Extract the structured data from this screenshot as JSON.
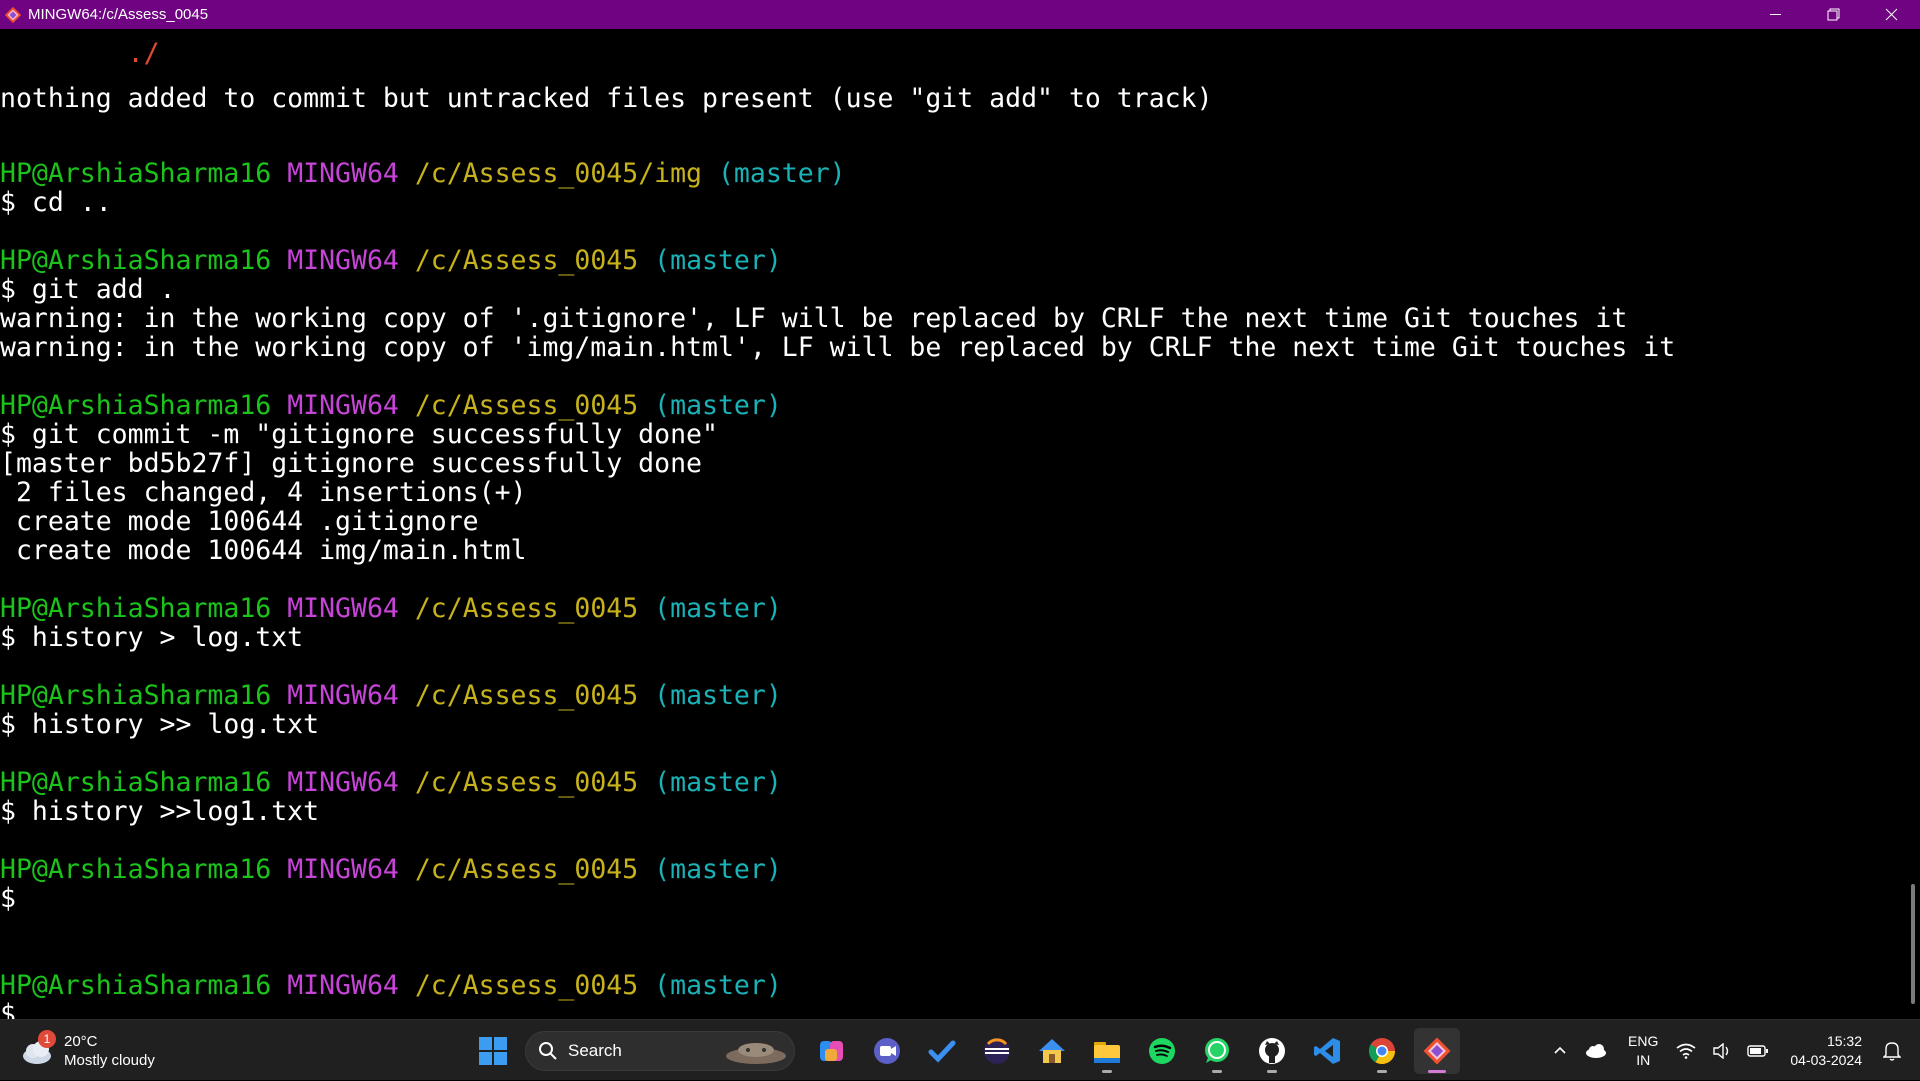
{
  "window": {
    "title": "MINGW64:/c/Assess_0045"
  },
  "terminal": {
    "lines": [
      {
        "top": 0,
        "segments": [
          {
            "text": "        ./",
            "color": "#e04a3a"
          }
        ]
      },
      {
        "top": 0,
        "segments": [
          {
            "text": "nothing added to commit but untracked files present (use \"git add\" to track)",
            "color": "#ffffff"
          }
        ]
      },
      {
        "top": 0,
        "segments": []
      },
      {
        "top": 0,
        "segments": [
          {
            "text": "HP@ArshiaSharma16",
            "cls": "c-green"
          },
          {
            "text": " MINGW64",
            "cls": "c-purple"
          },
          {
            "text": " /c/Assess_0045/img",
            "cls": "c-yellow"
          },
          {
            "text": " (master)",
            "cls": "c-cyan"
          }
        ]
      },
      {
        "top": 0,
        "segments": [
          {
            "text": "$ cd .."
          }
        ]
      },
      {
        "top": 0,
        "segments": [
          {
            "text": "HP@ArshiaSharma16",
            "cls": "c-green"
          },
          {
            "text": " MINGW64",
            "cls": "c-purple"
          },
          {
            "text": " /c/Assess_0045",
            "cls": "c-yellow"
          },
          {
            "text": " (master)",
            "cls": "c-cyan"
          }
        ]
      },
      {
        "top": 0,
        "segments": [
          {
            "text": "$ git add ."
          }
        ]
      },
      {
        "top": 0,
        "segments": [
          {
            "text": "warning: in the working copy of '.gitignore', LF will be replaced by CRLF the next time Git touches it"
          }
        ]
      },
      {
        "top": 0,
        "segments": [
          {
            "text": "warning: in the working copy of 'img/main.html', LF will be replaced by CRLF the next time Git touches it"
          }
        ]
      },
      {
        "top": 0,
        "segments": [
          {
            "text": "HP@ArshiaSharma16",
            "cls": "c-green"
          },
          {
            "text": " MINGW64",
            "cls": "c-purple"
          },
          {
            "text": " /c/Assess_0045",
            "cls": "c-yellow"
          },
          {
            "text": " (master)",
            "cls": "c-cyan"
          }
        ]
      },
      {
        "top": 0,
        "segments": [
          {
            "text": "$ git commit -m \"gitignore successfully done\""
          }
        ]
      },
      {
        "top": 0,
        "segments": [
          {
            "text": "[master bd5b27f] gitignore successfully done"
          }
        ]
      },
      {
        "top": 0,
        "segments": [
          {
            "text": " 2 files changed, 4 insertions(+)"
          }
        ]
      },
      {
        "top": 0,
        "segments": [
          {
            "text": " create mode 100644 .gitignore"
          }
        ]
      },
      {
        "top": 0,
        "segments": [
          {
            "text": " create mode 100644 img/main.html"
          }
        ]
      },
      {
        "top": 0,
        "segments": [
          {
            "text": "HP@ArshiaSharma16",
            "cls": "c-green"
          },
          {
            "text": " MINGW64",
            "cls": "c-purple"
          },
          {
            "text": " /c/Assess_0045",
            "cls": "c-yellow"
          },
          {
            "text": " (master)",
            "cls": "c-cyan"
          }
        ]
      },
      {
        "top": 0,
        "segments": [
          {
            "text": "$ history > log.txt"
          }
        ]
      },
      {
        "top": 0,
        "segments": [
          {
            "text": "HP@ArshiaSharma16",
            "cls": "c-green"
          },
          {
            "text": " MINGW64",
            "cls": "c-purple"
          },
          {
            "text": " /c/Assess_0045",
            "cls": "c-yellow"
          },
          {
            "text": " (master)",
            "cls": "c-cyan"
          }
        ]
      },
      {
        "top": 0,
        "segments": [
          {
            "text": "$ history >> log.txt"
          }
        ]
      },
      {
        "top": 0,
        "segments": [
          {
            "text": "HP@ArshiaSharma16",
            "cls": "c-green"
          },
          {
            "text": " MINGW64",
            "cls": "c-purple"
          },
          {
            "text": " /c/Assess_0045",
            "cls": "c-yellow"
          },
          {
            "text": " (master)",
            "cls": "c-cyan"
          }
        ]
      },
      {
        "top": 0,
        "segments": [
          {
            "text": "$ history >>log1.txt"
          }
        ]
      },
      {
        "top": 0,
        "segments": [
          {
            "text": "HP@ArshiaSharma16",
            "cls": "c-green"
          },
          {
            "text": " MINGW64",
            "cls": "c-purple"
          },
          {
            "text": " /c/Assess_0045",
            "cls": "c-yellow"
          },
          {
            "text": " (master)",
            "cls": "c-cyan"
          }
        ]
      },
      {
        "top": 0,
        "segments": [
          {
            "text": "$"
          }
        ]
      },
      {
        "top": 0,
        "segments": [
          {
            "text": "HP@ArshiaSharma16",
            "cls": "c-green"
          },
          {
            "text": " MINGW64",
            "cls": "c-purple"
          },
          {
            "text": " /c/Assess_0045",
            "cls": "c-yellow"
          },
          {
            "text": " (master)",
            "cls": "c-cyan"
          }
        ]
      },
      {
        "top": 0,
        "segments": [
          {
            "text": "$"
          }
        ]
      }
    ]
  },
  "taskbar": {
    "weather": {
      "badge": "1",
      "temp": "20°C",
      "condition": "Mostly cloudy"
    },
    "search_label": "Search",
    "apps": [
      "copilot-icon",
      "meet-icon",
      "todo-icon",
      "eclipse-icon",
      "home-icon",
      "file-explorer-icon",
      "spotify-icon",
      "whatsapp-icon",
      "github-icon",
      "vscode-icon",
      "chrome-icon",
      "git-bash-icon"
    ],
    "lang_line1": "ENG",
    "lang_line2": "IN",
    "time": "15:32",
    "date": "04-03-2024"
  },
  "colors": {
    "titlebar": "#700382",
    "prompt_user": "#1bc31b",
    "prompt_system": "#c744d8",
    "prompt_path": "#c7b21b",
    "prompt_branch": "#1ab2b6"
  }
}
